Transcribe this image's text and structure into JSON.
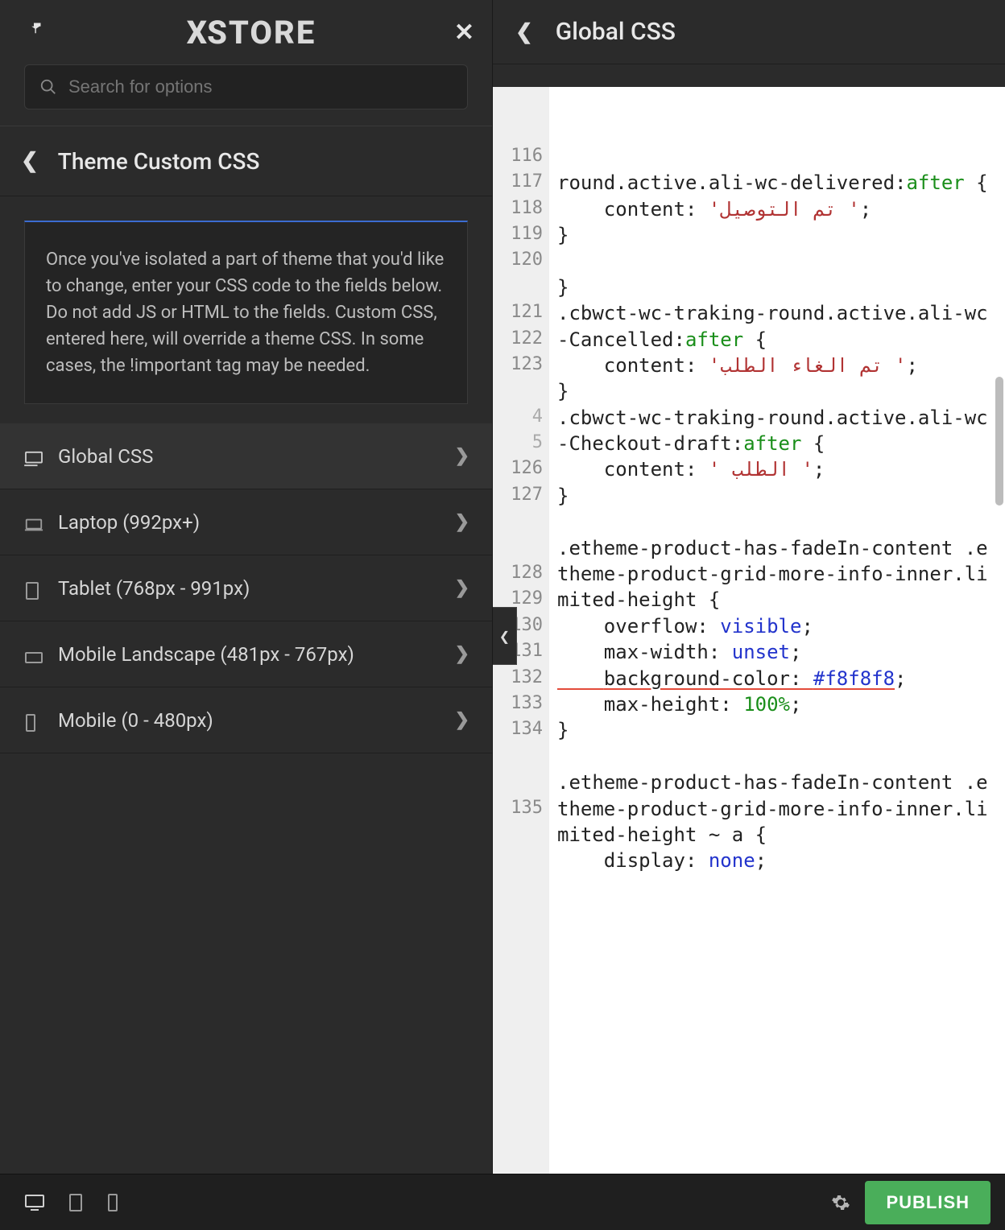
{
  "header": {
    "logo_text": "XSTORE"
  },
  "search": {
    "placeholder": "Search for options"
  },
  "section": {
    "title": "Theme Custom CSS",
    "description": "Once you've isolated a part of theme that you'd like to change, enter your CSS code to the fields below. Do not add JS or HTML to the fields. Custom CSS, entered here, will override a theme CSS. In some cases, the !important tag may be needed."
  },
  "nav_items": [
    {
      "label": "Global CSS",
      "active": true
    },
    {
      "label": "Laptop (992px+)",
      "active": false
    },
    {
      "label": "Tablet (768px - 991px)",
      "active": false
    },
    {
      "label": "Mobile Landscape (481px - 767px)",
      "active": false
    },
    {
      "label": "Mobile (0 - 480px)",
      "active": false
    }
  ],
  "right": {
    "title": "Global CSS"
  },
  "editor": {
    "lines": [
      {
        "num": "",
        "segs": [
          {
            "t": "round.active.ali-wc-delivered:"
          },
          {
            "t": "after",
            "c": "g"
          },
          {
            "t": " {"
          }
        ]
      },
      {
        "num": "116",
        "segs": [
          {
            "t": "    content: "
          },
          {
            "t": "'تم التوصيل '",
            "c": "r"
          },
          {
            "t": ";"
          }
        ]
      },
      {
        "num": "117",
        "segs": [
          {
            "t": "}"
          }
        ]
      },
      {
        "num": "118",
        "segs": [
          {
            "t": ""
          }
        ]
      },
      {
        "num": "119",
        "segs": [
          {
            "t": "}"
          }
        ]
      },
      {
        "num": "120",
        "segs": [
          {
            "t": ".cbwct-wc-traking-round.active.ali-wc-Cancelled:"
          },
          {
            "t": "after",
            "c": "g"
          },
          {
            "t": " {"
          }
        ]
      },
      {
        "num": "121",
        "segs": [
          {
            "t": "    content: "
          },
          {
            "t": "'تم الغاء الطلب '",
            "c": "r"
          },
          {
            "t": ";"
          }
        ]
      },
      {
        "num": "122",
        "segs": [
          {
            "t": "}"
          }
        ]
      },
      {
        "num": "123",
        "segs": [
          {
            "t": ".cbwct-wc-traking-round.active.ali-wc-Checkout-draft:"
          },
          {
            "t": "after",
            "c": "g"
          },
          {
            "t": " {"
          }
        ]
      },
      {
        "num": "4",
        "segs": [
          {
            "t": "    content: "
          },
          {
            "t": "' الطلب '",
            "c": "r"
          },
          {
            "t": ";"
          }
        ],
        "cutoff": true
      },
      {
        "num": "5",
        "segs": [
          {
            "t": "}"
          }
        ],
        "cutoff": true
      },
      {
        "num": "126",
        "segs": [
          {
            "t": ""
          }
        ]
      },
      {
        "num": "127",
        "segs": [
          {
            "t": ".etheme-product-has-fadeIn-content .etheme-product-grid-more-info-inner.limited-height {"
          }
        ]
      },
      {
        "num": "128",
        "segs": [
          {
            "t": "    overflow: "
          },
          {
            "t": "visible",
            "c": "b"
          },
          {
            "t": ";"
          }
        ]
      },
      {
        "num": "129",
        "segs": [
          {
            "t": "    max-width: "
          },
          {
            "t": "unset",
            "c": "b"
          },
          {
            "t": ";"
          }
        ]
      },
      {
        "num": "130",
        "segs": [
          {
            "t": "    background-color: ",
            "u": true
          },
          {
            "t": "#f8f8f8",
            "c": "b",
            "u": true
          },
          {
            "t": ";"
          }
        ]
      },
      {
        "num": "131",
        "segs": [
          {
            "t": "    max-height: "
          },
          {
            "t": "100%",
            "c": "g"
          },
          {
            "t": ";"
          }
        ]
      },
      {
        "num": "132",
        "segs": [
          {
            "t": "}"
          }
        ]
      },
      {
        "num": "133",
        "segs": [
          {
            "t": ""
          }
        ]
      },
      {
        "num": "134",
        "segs": [
          {
            "t": ".etheme-product-has-fadeIn-content .etheme-product-grid-more-info-inner.limited-height ~ a {"
          }
        ]
      },
      {
        "num": "135",
        "segs": [
          {
            "t": "    display: "
          },
          {
            "t": "none",
            "c": "b"
          },
          {
            "t": ";"
          }
        ]
      }
    ]
  },
  "footer": {
    "publish_label": "PUBLISH"
  }
}
